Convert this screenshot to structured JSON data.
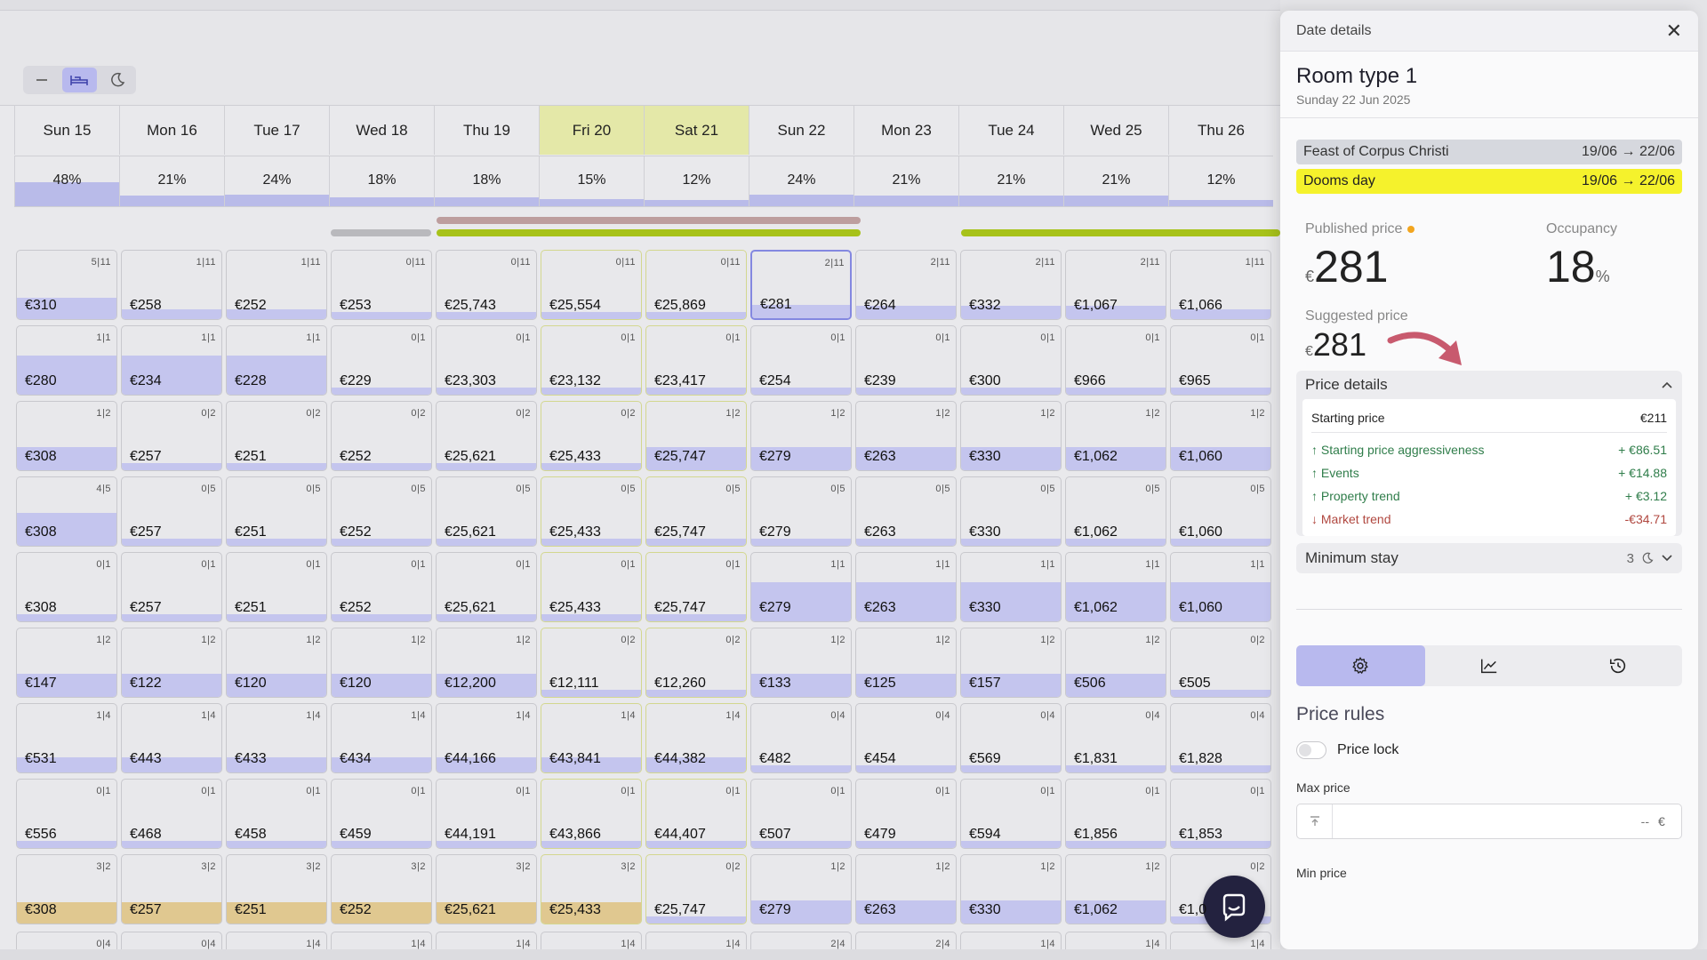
{
  "view_toggle": {
    "buttons": [
      {
        "name": "collapse-icon",
        "label": "—",
        "active": false
      },
      {
        "name": "bed-icon",
        "label": "",
        "active": true
      },
      {
        "name": "moon-icon",
        "label": "",
        "active": false
      }
    ]
  },
  "days": [
    {
      "label": "Sun 15",
      "occ": "48%",
      "weekend": false
    },
    {
      "label": "Mon 16",
      "occ": "21%",
      "weekend": false
    },
    {
      "label": "Tue 17",
      "occ": "24%",
      "weekend": false
    },
    {
      "label": "Wed 18",
      "occ": "18%",
      "weekend": false
    },
    {
      "label": "Thu 19",
      "occ": "18%",
      "weekend": false
    },
    {
      "label": "Fri 20",
      "occ": "15%",
      "weekend": true
    },
    {
      "label": "Sat 21",
      "occ": "12%",
      "weekend": true
    },
    {
      "label": "Sun 22",
      "occ": "24%",
      "weekend": false
    },
    {
      "label": "Mon 23",
      "occ": "21%",
      "weekend": false
    },
    {
      "label": "Tue 24",
      "occ": "21%",
      "weekend": false
    },
    {
      "label": "Wed 25",
      "occ": "21%",
      "weekend": false
    },
    {
      "label": "Thu 26",
      "occ": "12%",
      "weekend": false
    }
  ],
  "grid": [
    [
      [
        "5|11",
        "€310"
      ],
      [
        "1|11",
        "€258"
      ],
      [
        "1|11",
        "€252"
      ],
      [
        "0|11",
        "€253"
      ],
      [
        "0|11",
        "€25,743"
      ],
      [
        "0|11",
        "€25,554"
      ],
      [
        "0|11",
        "€25,869"
      ],
      [
        "2|11",
        "€281"
      ],
      [
        "2|11",
        "€264"
      ],
      [
        "2|11",
        "€332"
      ],
      [
        "2|11",
        "€1,067"
      ],
      [
        "1|11",
        "€1,066"
      ]
    ],
    [
      [
        "1|1",
        "€280"
      ],
      [
        "1|1",
        "€234"
      ],
      [
        "1|1",
        "€228"
      ],
      [
        "0|1",
        "€229"
      ],
      [
        "0|1",
        "€23,303"
      ],
      [
        "0|1",
        "€23,132"
      ],
      [
        "0|1",
        "€23,417"
      ],
      [
        "0|1",
        "€254"
      ],
      [
        "0|1",
        "€239"
      ],
      [
        "0|1",
        "€300"
      ],
      [
        "0|1",
        "€966"
      ],
      [
        "0|1",
        "€965"
      ]
    ],
    [
      [
        "1|2",
        "€308"
      ],
      [
        "0|2",
        "€257"
      ],
      [
        "0|2",
        "€251"
      ],
      [
        "0|2",
        "€252"
      ],
      [
        "0|2",
        "€25,621"
      ],
      [
        "0|2",
        "€25,433"
      ],
      [
        "1|2",
        "€25,747"
      ],
      [
        "1|2",
        "€279"
      ],
      [
        "1|2",
        "€263"
      ],
      [
        "1|2",
        "€330"
      ],
      [
        "1|2",
        "€1,062"
      ],
      [
        "1|2",
        "€1,060"
      ]
    ],
    [
      [
        "4|5",
        "€308"
      ],
      [
        "0|5",
        "€257"
      ],
      [
        "0|5",
        "€251"
      ],
      [
        "0|5",
        "€252"
      ],
      [
        "0|5",
        "€25,621"
      ],
      [
        "0|5",
        "€25,433"
      ],
      [
        "0|5",
        "€25,747"
      ],
      [
        "0|5",
        "€279"
      ],
      [
        "0|5",
        "€263"
      ],
      [
        "0|5",
        "€330"
      ],
      [
        "0|5",
        "€1,062"
      ],
      [
        "0|5",
        "€1,060"
      ]
    ],
    [
      [
        "0|1",
        "€308"
      ],
      [
        "0|1",
        "€257"
      ],
      [
        "0|1",
        "€251"
      ],
      [
        "0|1",
        "€252"
      ],
      [
        "0|1",
        "€25,621"
      ],
      [
        "0|1",
        "€25,433"
      ],
      [
        "0|1",
        "€25,747"
      ],
      [
        "1|1",
        "€279"
      ],
      [
        "1|1",
        "€263"
      ],
      [
        "1|1",
        "€330"
      ],
      [
        "1|1",
        "€1,062"
      ],
      [
        "1|1",
        "€1,060"
      ]
    ],
    [
      [
        "1|2",
        "€147"
      ],
      [
        "1|2",
        "€122"
      ],
      [
        "1|2",
        "€120"
      ],
      [
        "1|2",
        "€120"
      ],
      [
        "1|2",
        "€12,200"
      ],
      [
        "0|2",
        "€12,111"
      ],
      [
        "0|2",
        "€12,260"
      ],
      [
        "1|2",
        "€133"
      ],
      [
        "1|2",
        "€125"
      ],
      [
        "1|2",
        "€157"
      ],
      [
        "1|2",
        "€506"
      ],
      [
        "0|2",
        "€505"
      ]
    ],
    [
      [
        "1|4",
        "€531"
      ],
      [
        "1|4",
        "€443"
      ],
      [
        "1|4",
        "€433"
      ],
      [
        "1|4",
        "€434"
      ],
      [
        "1|4",
        "€44,166"
      ],
      [
        "1|4",
        "€43,841"
      ],
      [
        "1|4",
        "€44,382"
      ],
      [
        "0|4",
        "€482"
      ],
      [
        "0|4",
        "€454"
      ],
      [
        "0|4",
        "€569"
      ],
      [
        "0|4",
        "€1,831"
      ],
      [
        "0|4",
        "€1,828"
      ]
    ],
    [
      [
        "0|1",
        "€556"
      ],
      [
        "0|1",
        "€468"
      ],
      [
        "0|1",
        "€458"
      ],
      [
        "0|1",
        "€459"
      ],
      [
        "0|1",
        "€44,191"
      ],
      [
        "0|1",
        "€43,866"
      ],
      [
        "0|1",
        "€44,407"
      ],
      [
        "0|1",
        "€507"
      ],
      [
        "0|1",
        "€479"
      ],
      [
        "0|1",
        "€594"
      ],
      [
        "0|1",
        "€1,856"
      ],
      [
        "0|1",
        "€1,853"
      ]
    ],
    [
      [
        "3|2",
        "€308"
      ],
      [
        "3|2",
        "€257"
      ],
      [
        "3|2",
        "€251"
      ],
      [
        "3|2",
        "€252"
      ],
      [
        "3|2",
        "€25,621"
      ],
      [
        "3|2",
        "€25,433"
      ],
      [
        "0|2",
        "€25,747"
      ],
      [
        "1|2",
        "€279"
      ],
      [
        "1|2",
        "€263"
      ],
      [
        "1|2",
        "€330"
      ],
      [
        "1|2",
        "€1,062"
      ],
      [
        "0|2",
        "€1,0"
      ]
    ]
  ],
  "partial_row": [
    "0|4",
    "0|4",
    "1|4",
    "1|4",
    "1|4",
    "1|4",
    "1|4",
    "2|4",
    "2|4",
    "1|4",
    "1|4",
    "1|4"
  ],
  "panel": {
    "header": "Date details",
    "close": "✕",
    "room_type": "Room type 1",
    "date": "Sunday 22 Jun 2025",
    "events": [
      {
        "name": "Feast of Corpus Christi",
        "range": "19/06 → 22/06",
        "style": "grey"
      },
      {
        "name": "Dooms day",
        "range": "19/06 → 22/06",
        "style": "yellow"
      }
    ],
    "published_label": "Published price",
    "published_currency": "€",
    "published_value": "281",
    "occupancy_label": "Occupancy",
    "occupancy_value": "18",
    "occupancy_unit": "%",
    "suggested_label": "Suggested price",
    "suggested_currency": "€",
    "suggested_value": "281",
    "price_details_label": "Price details",
    "starting_label": "Starting price",
    "starting_value": "€211",
    "adjustments": [
      {
        "label": "Starting price aggressiveness",
        "value": "+ €86.51",
        "dir": "up"
      },
      {
        "label": "Events",
        "value": "+ €14.88",
        "dir": "up"
      },
      {
        "label": "Property trend",
        "value": "+ €3.12",
        "dir": "up"
      },
      {
        "label": "Market trend",
        "value": "-€34.71",
        "dir": "down"
      }
    ],
    "min_stay_label": "Minimum stay",
    "min_stay_value": "3",
    "rules_title": "Price rules",
    "price_lock_label": "Price lock",
    "max_price_label": "Max price",
    "max_price_placeholder": "--",
    "currency": "€",
    "min_price_label": "Min price"
  }
}
